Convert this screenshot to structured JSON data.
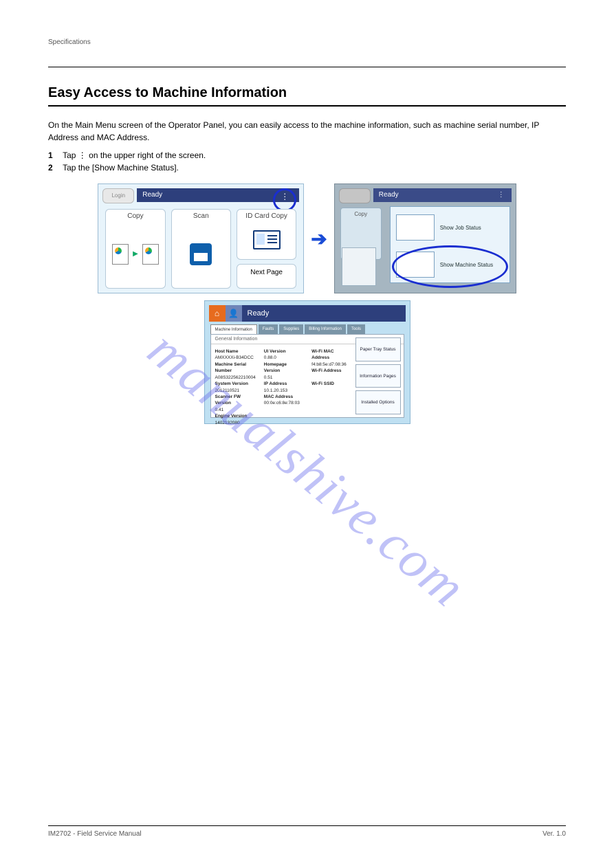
{
  "header": {
    "left": "Specifications",
    "right": ""
  },
  "section": {
    "title": "Easy Access to Machine Information",
    "intro": "On the Main Menu screen of the Operator Panel, you can easily access to the machine information, such as machine serial number, IP Address and MAC Address.",
    "steps": {
      "s1": {
        "num": "1",
        "text": "Tap  ⋮  on the upper right of the screen."
      },
      "s2": {
        "num": "2",
        "text": "Tap the [Show Machine Status]."
      }
    }
  },
  "shotA": {
    "login": "Login",
    "status": "Ready",
    "tiles": {
      "copy": "Copy",
      "scan": "Scan",
      "idcard": "ID Card Copy",
      "next": "Next Page"
    }
  },
  "shotB": {
    "status": "Ready",
    "bgcopy": "Copy",
    "row1": "Show Job Status",
    "row2": "Show Machine Status"
  },
  "shotC": {
    "title": "Ready",
    "tabs": {
      "t1": "Machine Information",
      "t2": "Faults",
      "t3": "Supplies",
      "t4": "Billing Information",
      "t5": "Tools"
    },
    "gi_head": "General Information",
    "col1": {
      "host_l": "Host Name",
      "host_v": "AMXXXXi-B34DCC",
      "msn_l": "Machine Serial Number",
      "msn_v": "A08S322562210004",
      "sys_l": "System Version",
      "sys_v": "2012110521",
      "scn_l": "Scanner FW Version",
      "scn_v": "0.41",
      "eng_l": "Engine Version",
      "eng_v": "1402132080"
    },
    "col2": {
      "ui_l": "UI Version",
      "ui_v": "0.88.0",
      "hp_l": "Homepage Version",
      "hp_v": "0.51",
      "ip_l": "IP Address",
      "ip_v": "10.1.20.153",
      "mac_l": "MAC Address",
      "mac_v": "00:0e:c6:8e:78:03"
    },
    "col3": {
      "wmac_l": "Wi-Fi MAC Address",
      "wmac_v": "f4:b8:5e:d7:08:36",
      "waddr_l": "Wi-Fi Address",
      "waddr_v": "",
      "wssid_l": "Wi-Fi SSID",
      "wssid_v": ""
    },
    "side": {
      "b1": "Paper Tray Status",
      "b2": "Information Pages",
      "b3": "Installed Options"
    }
  },
  "watermark": "manualshive.com",
  "footer": {
    "left": "IM2702 - Field Service Manual",
    "right": "Ver. 1.0"
  }
}
